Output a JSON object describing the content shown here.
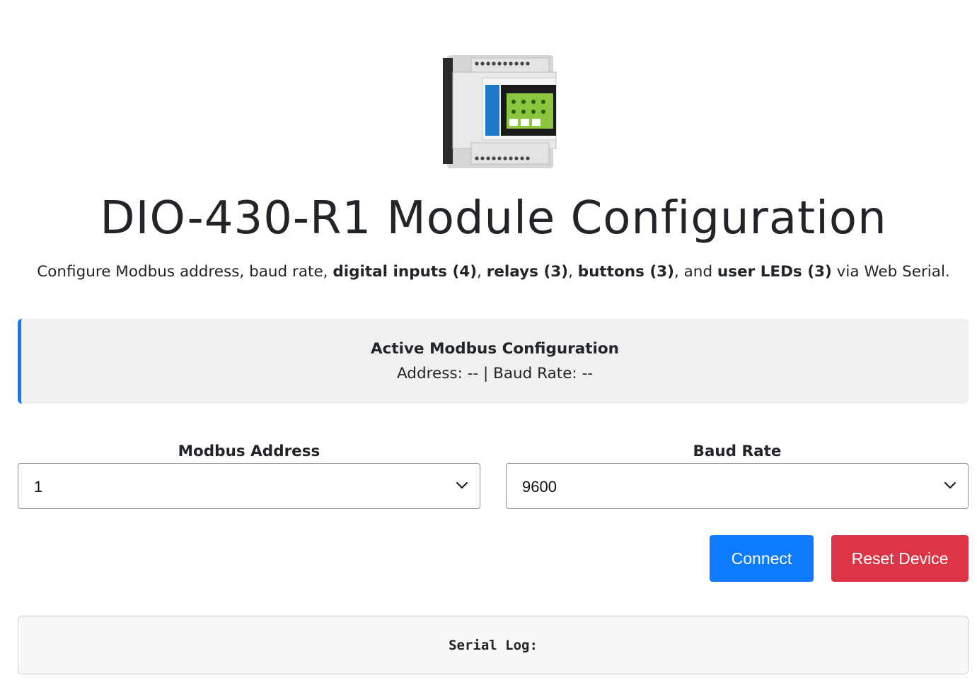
{
  "header": {
    "title": "DIO-430-R1 Module Configuration",
    "subtitle": {
      "p1": "Configure Modbus address, baud rate, ",
      "b1": "digital inputs (4)",
      "p2": ", ",
      "b2": "relays (3)",
      "p3": ", ",
      "b3": "buttons (3)",
      "p4": ", and ",
      "b4": "user LEDs (3)",
      "p5": " via Web Serial."
    }
  },
  "status": {
    "title": "Active Modbus Configuration",
    "line": "Address: -- | Baud Rate: --"
  },
  "form": {
    "address": {
      "label": "Modbus Address",
      "value": "1"
    },
    "baud": {
      "label": "Baud Rate",
      "value": "9600"
    }
  },
  "buttons": {
    "connect": "Connect",
    "reset": "Reset Device"
  },
  "log": {
    "title": "Serial Log:"
  },
  "colors": {
    "primary": "#0d7bff",
    "danger": "#dc3545",
    "module_green": "#8cc63f",
    "module_blue": "#1f78c8"
  }
}
